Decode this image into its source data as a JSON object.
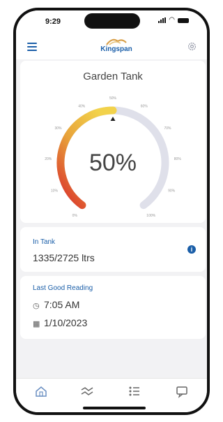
{
  "status_bar": {
    "time": "9:29"
  },
  "header": {
    "logo_text": "Kingspan"
  },
  "gauge": {
    "title": "Garden Tank",
    "percent_label": "50%",
    "level_fraction": 0.5,
    "tick_labels": [
      "0%",
      "10%",
      "20%",
      "30%",
      "40%",
      "50%",
      "60%",
      "70%",
      "80%",
      "90%",
      "100%"
    ],
    "colors": {
      "low": "#d92b2b",
      "mid": "#e8a33a",
      "high": "#f2d24b",
      "track": "#dfe0ea"
    }
  },
  "tank": {
    "label": "In Tank",
    "value": "1335/2725 ltrs"
  },
  "reading": {
    "label": "Last Good Reading",
    "time": "7:05 AM",
    "date": "1/10/2023"
  },
  "tabs": [
    {
      "icon": "home-icon"
    },
    {
      "icon": "trend-icon"
    },
    {
      "icon": "list-icon"
    },
    {
      "icon": "message-icon"
    }
  ]
}
